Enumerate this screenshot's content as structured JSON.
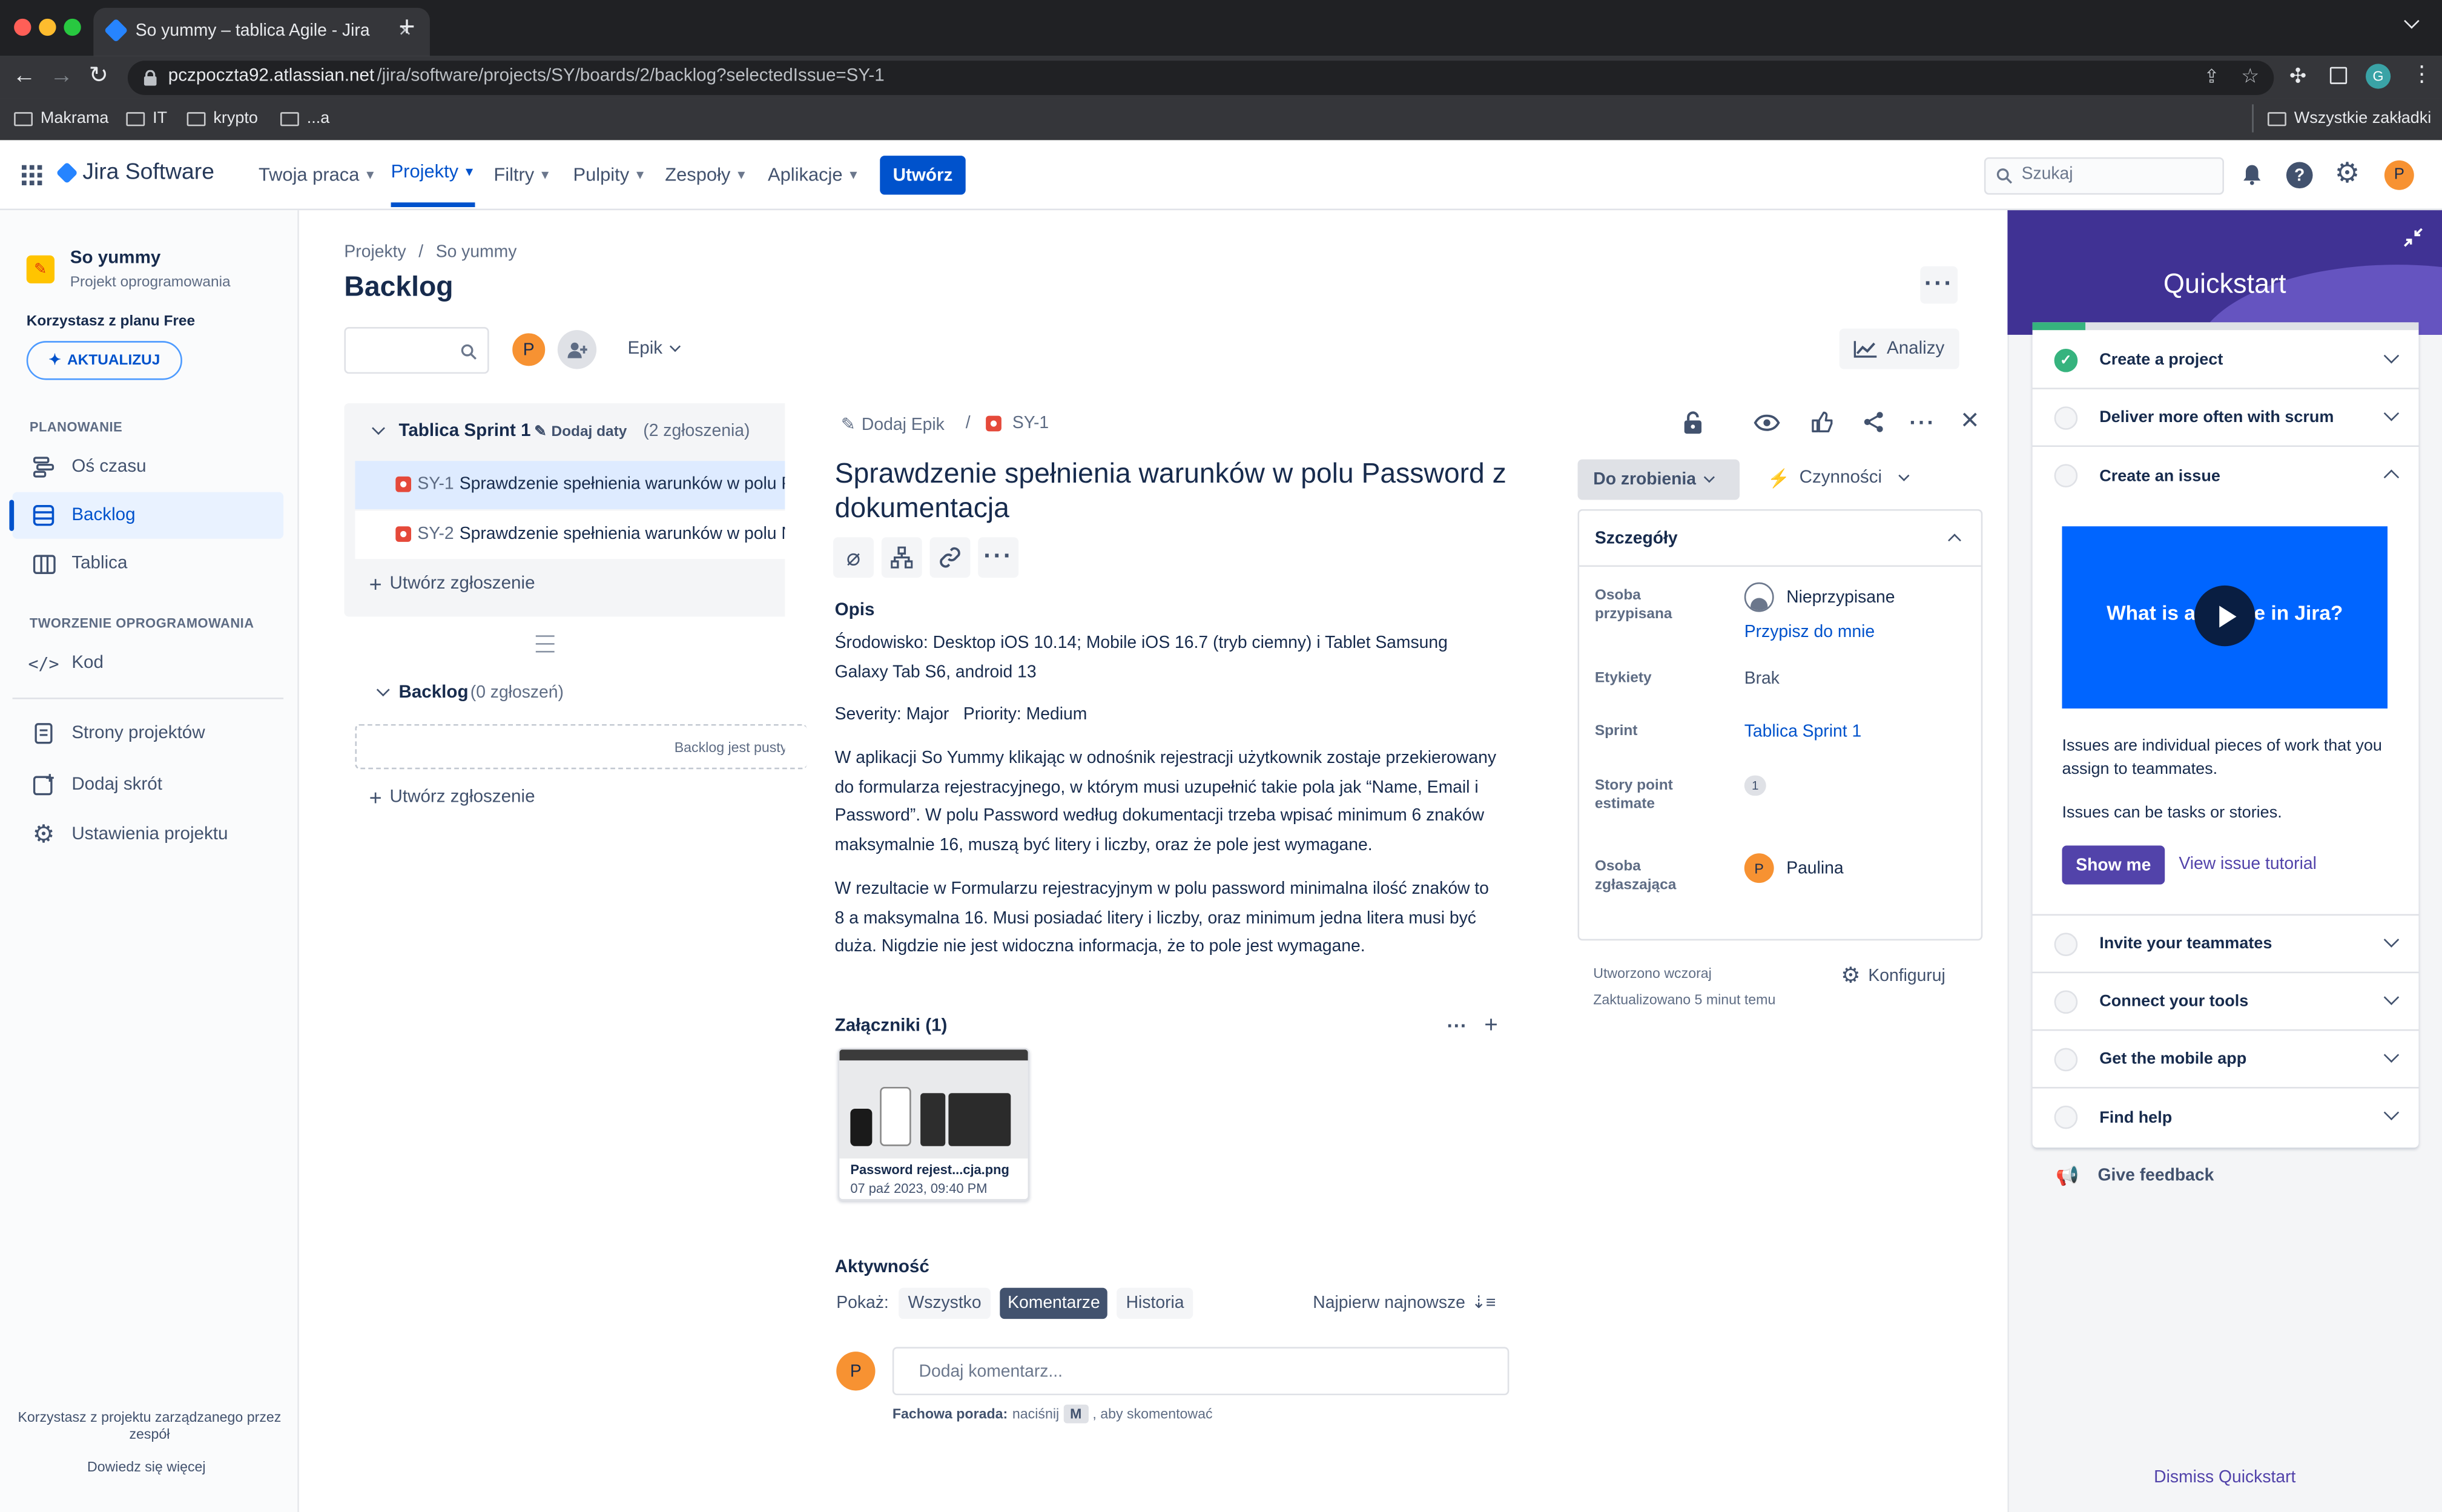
{
  "browser": {
    "tab_title": "So yummy – tablica Agile - Jira",
    "url_domain": "pczpoczta92.atlassian.net",
    "url_path": "/jira/software/projects/SY/boards/2/backlog?selectedIssue=SY-1",
    "profile_initial": "G",
    "bookmarks": [
      "Makrama",
      "IT",
      "krypto",
      "...a"
    ],
    "all_bookmarks": "Wszystkie zakładki"
  },
  "topnav": {
    "product": "Jira Software",
    "items": [
      "Twoja praca",
      "Projekty",
      "Filtry",
      "Pulpity",
      "Zespoły",
      "Aplikacje"
    ],
    "create": "Utwórz",
    "search_placeholder": "Szukaj",
    "avatar": "P"
  },
  "sidebar": {
    "project_name": "So yummy",
    "project_type": "Projekt oprogramowania",
    "plan_text": "Korzystasz z planu Free",
    "upgrade": "AKTUALIZUJ",
    "planning_header": "PLANOWANIE",
    "items": [
      "Oś czasu",
      "Backlog",
      "Tablica"
    ],
    "dev_header": "TWORZENIE OPROGRAMOWANIA",
    "code": "Kod",
    "pages": "Strony projektów",
    "add_shortcut": "Dodaj skrót",
    "settings": "Ustawienia projektu",
    "footer_text": "Korzystasz z projektu zarządzanego przez zespół",
    "footer_link": "Dowiedz się więcej"
  },
  "board": {
    "breadcrumb_projects": "Projekty",
    "breadcrumb_sep": "/",
    "breadcrumb_project": "So yummy",
    "title": "Backlog",
    "avatar": "P",
    "epic_filter": "Epik",
    "insights": "Analizy",
    "sprint_name": "Tablica Sprint 1",
    "add_dates": "Dodaj daty",
    "sprint_count": "(2 zgłoszenia)",
    "issues": [
      {
        "key": "SY-1",
        "summary": "Sprawdzenie spełnienia warunków w polu Password"
      },
      {
        "key": "SY-2",
        "summary": "Sprawdzenie spełnienia warunków w polu Name"
      }
    ],
    "create_issue": "Utwórz zgłoszenie",
    "backlog_name": "Backlog",
    "backlog_count": "(0 zgłoszeń)",
    "backlog_empty": "Backlog jest pusty.",
    "create_issue_2": "Utwórz zgłoszenie"
  },
  "issue": {
    "add_epic": "Dodaj Epik",
    "sep": "/",
    "key": "SY-1",
    "title": "Sprawdzenie spełnienia warunków w polu Password z dokumentacja",
    "desc_label": "Opis",
    "desc_p1": "Środowisko: Desktop iOS 10.14; Mobile  iOS 16.7 (tryb ciemny) i Tablet Samsung Galaxy Tab S6, android 13",
    "desc_p2": "Severity: Major   Priority: Medium",
    "desc_p3": "W aplikacji So Yummy klikając w odnośnik rejestracji użytkownik zostaje przekierowany do formularza rejestracyjnego, w którym musi uzupełnić takie pola jak “Name, Email i Password”. W polu Password według dokumentacji trzeba wpisać minimum 6 znaków maksymalnie 16, muszą być litery i liczby, oraz że pole jest wymagane.",
    "desc_p4": "W rezultacie w Formularzu rejestracyjnym w polu password minimalna ilość znaków to 8 a maksymalna 16. Musi posiadać litery i liczby, oraz minimum jedna litera musi być duża.  Nigdzie nie jest widoczna informacja, że to pole jest wymagane.",
    "attachments_label": "Załączniki (1)",
    "attachment_name": "Password rejest...cja.png",
    "attachment_date": "07 paź 2023, 09:40 PM",
    "activity_label": "Aktywność",
    "show_label": "Pokaż:",
    "filters": [
      "Wszystko",
      "Komentarze",
      "Historia"
    ],
    "sort": "Najpierw najnowsze",
    "comment_avatar": "P",
    "comment_placeholder": "Dodaj komentarz...",
    "tip_bold": "Fachowa porada:",
    "tip_text": "naciśnij",
    "tip_key": "M",
    "tip_text2": ", aby skomentować",
    "status": "Do zrobienia",
    "actions": "Czynności",
    "details_label": "Szczegóły",
    "assignee_label": "Osoba przypisana",
    "assignee_value": "Nieprzypisane",
    "assign_me": "Przypisz do mnie",
    "labels_label": "Etykiety",
    "labels_value": "Brak",
    "sprint_label": "Sprint",
    "sprint_value": "Tablica Sprint 1",
    "sp_label": "Story point estimate",
    "sp_value": "1",
    "reporter_label": "Osoba zgłaszająca",
    "reporter_avatar": "P",
    "reporter_value": "Paulina",
    "created": "Utworzono wczoraj",
    "updated": "Zaktualizowano 5 minut temu",
    "configure": "Konfiguruj"
  },
  "quickstart": {
    "title": "Quickstart",
    "items_top": [
      "Create a project",
      "Deliver more often with scrum",
      "Create an issue"
    ],
    "video_text": "What is an issue in Jira?",
    "desc1": "Issues are individual pieces of work that you assign to teammates.",
    "desc2": "Issues can be tasks or stories.",
    "show_me": "Show me",
    "tutorial": "View issue tutorial",
    "items_bottom": [
      "Invite your teammates",
      "Connect your tools",
      "Get the mobile app",
      "Find help"
    ],
    "feedback": "Give feedback",
    "dismiss": "Dismiss Quickstart"
  },
  "colors": {
    "brand": "#0052cc",
    "purple": "#5243aa",
    "avatar": "#f79232",
    "bug": "#e5493a"
  }
}
